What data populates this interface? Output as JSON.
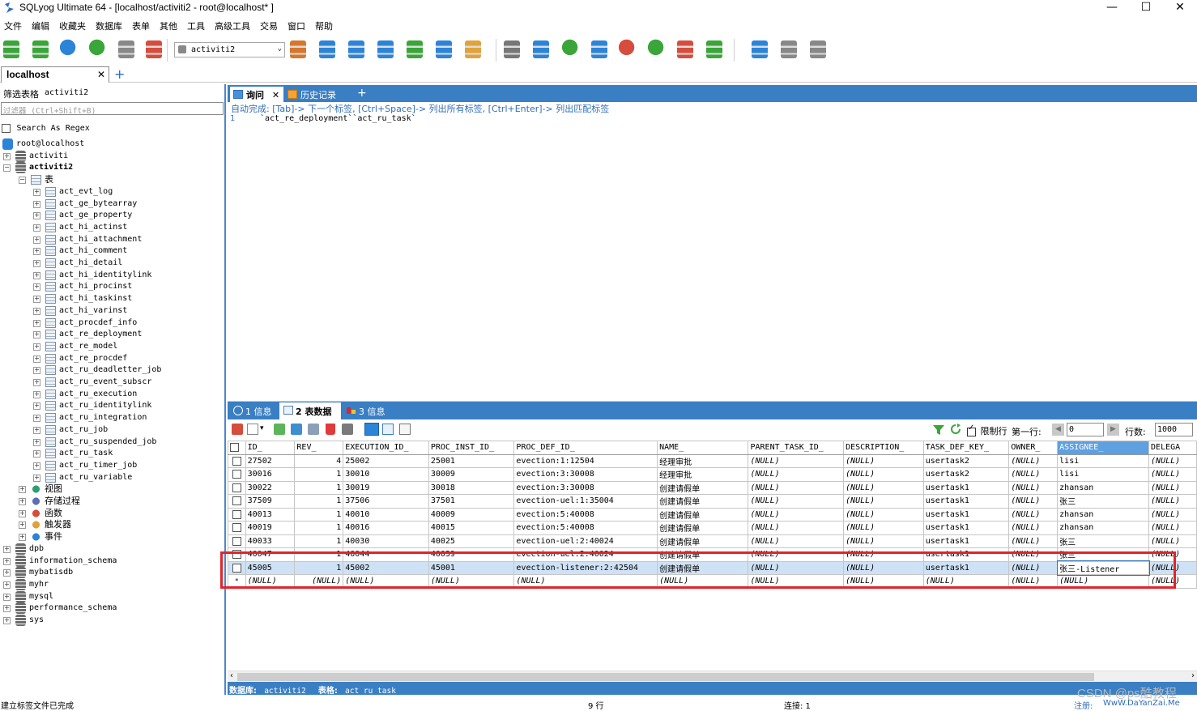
{
  "window": {
    "title": "SQLyog Ultimate 64 - [localhost/activiti2 - root@localhost* ]",
    "controls": [
      "—",
      "☐",
      "✕"
    ]
  },
  "menu": [
    "文件",
    "编辑",
    "收藏夹",
    "数据库",
    "表单",
    "其他",
    "工具",
    "高级工具",
    "交易",
    "窗口",
    "帮助"
  ],
  "toolbar": {
    "db_select": "activiti2",
    "icons": [
      "new-connection-icon",
      "new-query-icon",
      "execute-icon",
      "execute-all-icon",
      "execute-edit-icon",
      "schema-designer-icon",
      "user-manager-icon",
      "create-db-icon",
      "create-table-icon",
      "alter-table-icon",
      "import-icon",
      "export-icon",
      "data-sync-icon",
      "backup-icon",
      "restore-icon",
      "query-builder-icon",
      "schema-sync-icon",
      "scheduled-job-icon",
      "refresh-icon",
      "sql-log-icon",
      "migration-icon",
      "notification-icon",
      "clone-icon",
      "copy-db-icon",
      "compare-icon",
      "monitor-icon"
    ]
  },
  "connection_tab": {
    "label": "localhost",
    "close": "✕",
    "add": "+"
  },
  "sidebar": {
    "filter_label": "筛选表格",
    "filter_db": "activiti2",
    "filter_placeholder": "过滤器 (Ctrl+Shift+B)",
    "regex_label": "Search As Regex",
    "tree": {
      "root": "root@localhost",
      "databases_before": [
        "activiti"
      ],
      "current_db": "activiti2",
      "tables_folder": "表",
      "tables": [
        "act_evt_log",
        "act_ge_bytearray",
        "act_ge_property",
        "act_hi_actinst",
        "act_hi_attachment",
        "act_hi_comment",
        "act_hi_detail",
        "act_hi_identitylink",
        "act_hi_procinst",
        "act_hi_taskinst",
        "act_hi_varinst",
        "act_procdef_info",
        "act_re_deployment",
        "act_re_model",
        "act_re_procdef",
        "act_ru_deadletter_job",
        "act_ru_event_subscr",
        "act_ru_execution",
        "act_ru_identitylink",
        "act_ru_integration",
        "act_ru_job",
        "act_ru_suspended_job",
        "act_ru_task",
        "act_ru_timer_job",
        "act_ru_variable"
      ],
      "other_folders": [
        "视图",
        "存储过程",
        "函数",
        "触发器",
        "事件"
      ],
      "databases_after": [
        "dpb",
        "information_schema",
        "mybatisdb",
        "myhr",
        "mysql",
        "performance_schema",
        "sys"
      ]
    }
  },
  "query_tabs": [
    {
      "label": "询问",
      "close": "✕"
    },
    {
      "label": "历史记录"
    },
    {
      "label": "+"
    }
  ],
  "editor": {
    "hint": "自动完成:  [Tab]-> 下一个标签,  [Ctrl+Space]-> 列出所有标签,  [Ctrl+Enter]-> 列出匹配标签",
    "line_no": "1",
    "line": "`act_re_deployment``act_ru_task`"
  },
  "result_tabs": [
    {
      "num": "1",
      "label": "信息"
    },
    {
      "num": "2",
      "label": "表数据"
    },
    {
      "num": "3",
      "label": "信息"
    }
  ],
  "result_toolbar": {
    "limit_label": "限制行",
    "first_row_label": "第一行:",
    "first_row_value": "0",
    "rows_label": "行数:",
    "rows_value": "1000"
  },
  "grid": {
    "columns": [
      "ID_",
      "REV_",
      "EXECUTION_ID_",
      "PROC_INST_ID_",
      "PROC_DEF_ID_",
      "NAME_",
      "PARENT_TASK_ID_",
      "DESCRIPTION_",
      "TASK_DEF_KEY_",
      "OWNER_",
      "ASSIGNEE_",
      "DELEGA"
    ],
    "rows": [
      [
        "27502",
        "4",
        "25002",
        "25001",
        "evection:1:12504",
        "经理审批",
        "(NULL)",
        "(NULL)",
        "usertask2",
        "(NULL)",
        "lisi",
        "(NULL)"
      ],
      [
        "30016",
        "1",
        "30010",
        "30009",
        "evection:3:30008",
        "经理审批",
        "(NULL)",
        "(NULL)",
        "usertask2",
        "(NULL)",
        "lisi",
        "(NULL)"
      ],
      [
        "30022",
        "1",
        "30019",
        "30018",
        "evection:3:30008",
        "创建请假单",
        "(NULL)",
        "(NULL)",
        "usertask1",
        "(NULL)",
        "zhansan",
        "(NULL)"
      ],
      [
        "37509",
        "1",
        "37506",
        "37501",
        "evection-uel:1:35004",
        "创建请假单",
        "(NULL)",
        "(NULL)",
        "usertask1",
        "(NULL)",
        "张三",
        "(NULL)"
      ],
      [
        "40013",
        "1",
        "40010",
        "40009",
        "evection:5:40008",
        "创建请假单",
        "(NULL)",
        "(NULL)",
        "usertask1",
        "(NULL)",
        "zhansan",
        "(NULL)"
      ],
      [
        "40019",
        "1",
        "40016",
        "40015",
        "evection:5:40008",
        "创建请假单",
        "(NULL)",
        "(NULL)",
        "usertask1",
        "(NULL)",
        "zhansan",
        "(NULL)"
      ],
      [
        "40033",
        "1",
        "40030",
        "40025",
        "evection-uel:2:40024",
        "创建请假单",
        "(NULL)",
        "(NULL)",
        "usertask1",
        "(NULL)",
        "张三",
        "(NULL)"
      ],
      [
        "40047",
        "1",
        "40044",
        "40039",
        "evection-uel:2:40024",
        "创建请假单",
        "(NULL)",
        "(NULL)",
        "usertask1",
        "(NULL)",
        "张三",
        "(NULL)"
      ],
      [
        "45005",
        "1",
        "45002",
        "45001",
        "evection-listener:2:42504",
        "创建请假单",
        "(NULL)",
        "(NULL)",
        "usertask1",
        "(NULL)",
        "张三-Listener",
        "(NULL)"
      ],
      [
        "(NULL)",
        "(NULL)",
        "(NULL)",
        "(NULL)",
        "(NULL)",
        "(NULL)",
        "(NULL)",
        "(NULL)",
        "(NULL)",
        "(NULL)",
        "(NULL)",
        "(NULL)"
      ]
    ],
    "row_markers": [
      "",
      "",
      "",
      "",
      "",
      "",
      "",
      "",
      "",
      "*"
    ],
    "selected_row": 8
  },
  "status": {
    "db_label": "数据库:",
    "db_value": "activiti2",
    "table_label": "表格:",
    "table_value": "act_ru_task"
  },
  "bottom": {
    "left": "建立标签文件已完成",
    "rows": "9 行",
    "conn": "连接: 1",
    "register": "注册:",
    "site": "WwW.DaYanZai.Me",
    "watermark": "CSDN @ps酷教程"
  }
}
